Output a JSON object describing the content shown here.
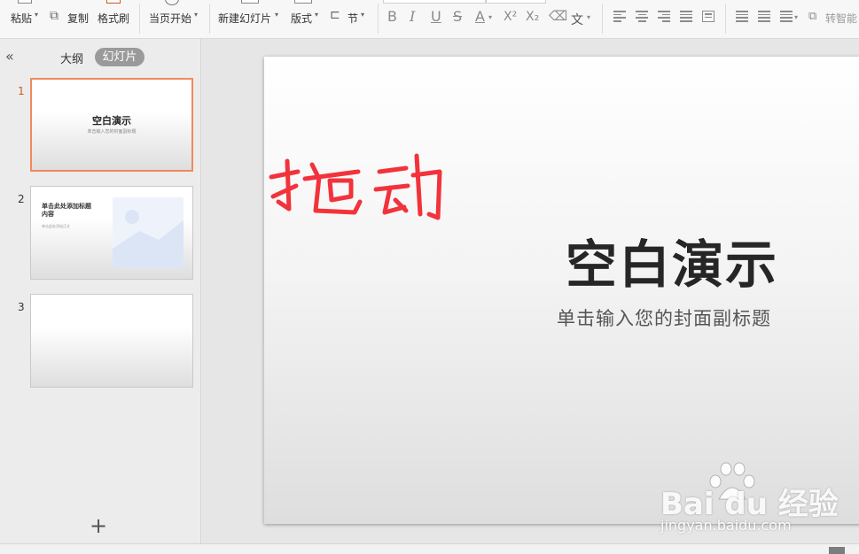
{
  "toolbar": {
    "paste": "粘贴",
    "copy": "复制",
    "format_painter": "格式刷",
    "from_current": "当页开始",
    "new_slide": "新建幻灯片",
    "layout": "版式",
    "section": "节",
    "bold": "B",
    "italic": "I",
    "underline": "U",
    "strike": "S",
    "font_color": "A",
    "superscript": "X²",
    "subscript": "X₂",
    "phonetic": "文",
    "smart_art": "转智能"
  },
  "panel": {
    "collapse": "«",
    "tab_outline": "大纲",
    "tab_slides": "幻灯片",
    "add_slide": "+"
  },
  "slides": [
    {
      "number": "1",
      "title": "空白演示",
      "subtitle": "单击输入您的封面副标题"
    },
    {
      "number": "2",
      "title": "单击此处添加标题内容",
      "subtitle": "单击此处添加正文"
    },
    {
      "number": "3"
    }
  ],
  "main_slide": {
    "title": "空白演示",
    "subtitle": "单击输入您的封面副标题",
    "annotation": "拖动"
  },
  "watermark": {
    "brand": "Bai du 经验",
    "url": "jingyan.baidu.com"
  },
  "colors": {
    "accent": "#f08a5d",
    "annotation": "#f2333b"
  }
}
